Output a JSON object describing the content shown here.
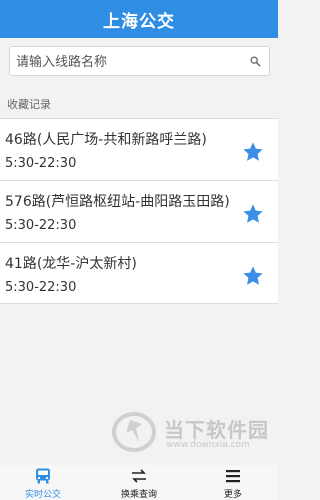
{
  "header": {
    "title": "上海公交"
  },
  "search": {
    "placeholder": "请输入线路名称",
    "icon": "search-icon"
  },
  "favorites": {
    "section_label": "收藏记录",
    "items": [
      {
        "name": "46路(人民广场-共和新路呼兰路)",
        "time": "5:30-22:30",
        "starred": true
      },
      {
        "name": "576路(芦恒路枢纽站-曲阳路玉田路)",
        "time": "5:30-22:30",
        "starred": true
      },
      {
        "name": "41路(龙华-沪太新村)",
        "time": "5:30-22:30",
        "starred": true
      }
    ]
  },
  "tabs": [
    {
      "label": "实时公交",
      "icon": "bus-icon",
      "active": true
    },
    {
      "label": "换乘查询",
      "icon": "transfer-icon",
      "active": false
    },
    {
      "label": "更多",
      "icon": "more-icon",
      "active": false
    }
  ],
  "watermark": {
    "brand": "当下软件园",
    "url": "www.downxia.com"
  },
  "colors": {
    "accent": "#2f8de4",
    "star": "#3a8ee6",
    "background": "#f2f2f2"
  }
}
